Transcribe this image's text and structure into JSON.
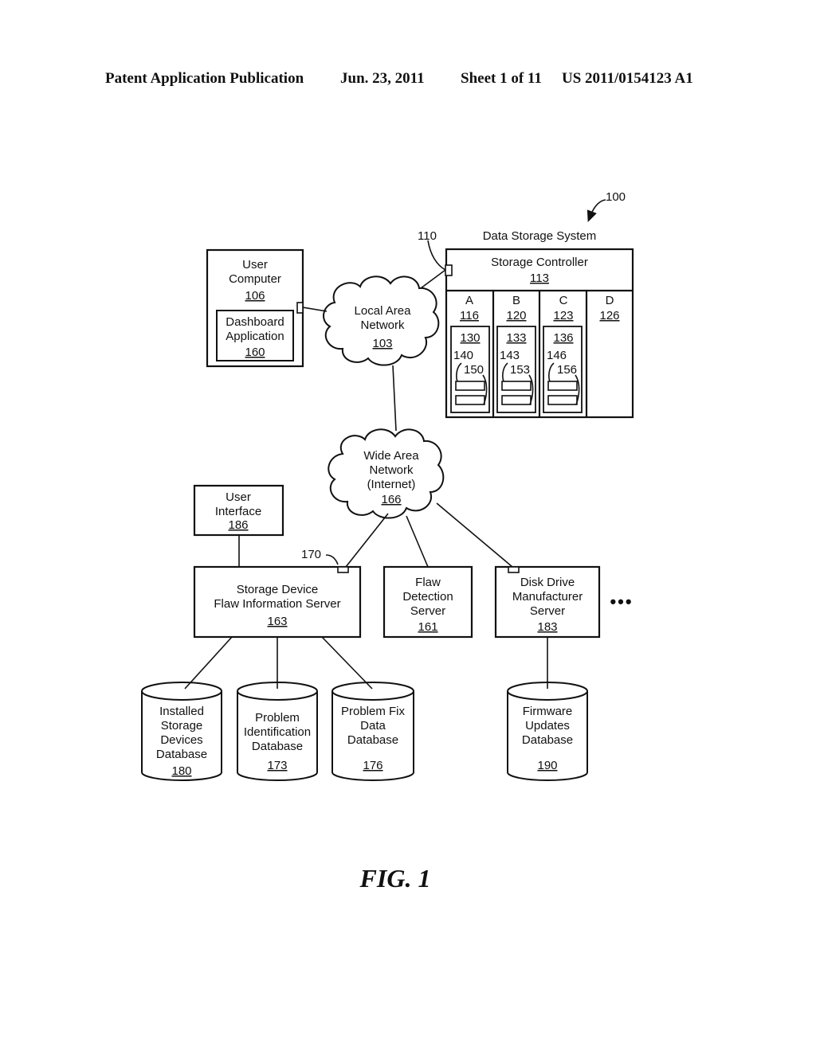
{
  "header": {
    "publication": "Patent Application Publication",
    "date": "Jun. 23, 2011",
    "sheet": "Sheet 1 of 11",
    "number": "US 2011/0154123 A1"
  },
  "figure": {
    "label": "FIG. 1",
    "system_ref": "100"
  },
  "data_storage_system": {
    "title": "Data Storage System",
    "port_ref": "110",
    "controller": {
      "label": "Storage Controller",
      "ref": "113"
    },
    "slots": [
      {
        "letter": "A",
        "ref": "116",
        "drive_ref": "130",
        "lead1": "140",
        "lead2": "150"
      },
      {
        "letter": "B",
        "ref": "120",
        "drive_ref": "133",
        "lead1": "143",
        "lead2": "153"
      },
      {
        "letter": "C",
        "ref": "123",
        "drive_ref": "136",
        "lead1": "146",
        "lead2": "156"
      },
      {
        "letter": "D",
        "ref": "126"
      }
    ]
  },
  "user_computer": {
    "line1": "User",
    "line2": "Computer",
    "ref": "106",
    "app": {
      "line1": "Dashboard",
      "line2": "Application",
      "ref": "160"
    }
  },
  "lan": {
    "line1": "Local Area",
    "line2": "Network",
    "ref": "103"
  },
  "wan": {
    "line1": "Wide Area",
    "line2": "Network",
    "line3": "(Internet)",
    "ref": "166"
  },
  "user_interface": {
    "line1": "User",
    "line2": "Interface",
    "ref": "186"
  },
  "flaw_info_server": {
    "line1": "Storage Device",
    "line2": "Flaw Information Server",
    "ref": "163",
    "port_ref": "170"
  },
  "flaw_detection_server": {
    "line1": "Flaw",
    "line2": "Detection",
    "line3": "Server",
    "ref": "161"
  },
  "manufacturer_server": {
    "line1": "Disk Drive",
    "line2": "Manufacturer",
    "line3": "Server",
    "ref": "183"
  },
  "ellipsis": "•••",
  "databases": [
    {
      "lines": [
        "Installed",
        "Storage",
        "Devices",
        "Database"
      ],
      "ref": "180"
    },
    {
      "lines": [
        "Problem",
        "Identification",
        "Database"
      ],
      "ref": "173"
    },
    {
      "lines": [
        "Problem Fix",
        "Data",
        "Database"
      ],
      "ref": "176"
    },
    {
      "lines": [
        "Firmware",
        "Updates",
        "Database"
      ],
      "ref": "190"
    }
  ]
}
